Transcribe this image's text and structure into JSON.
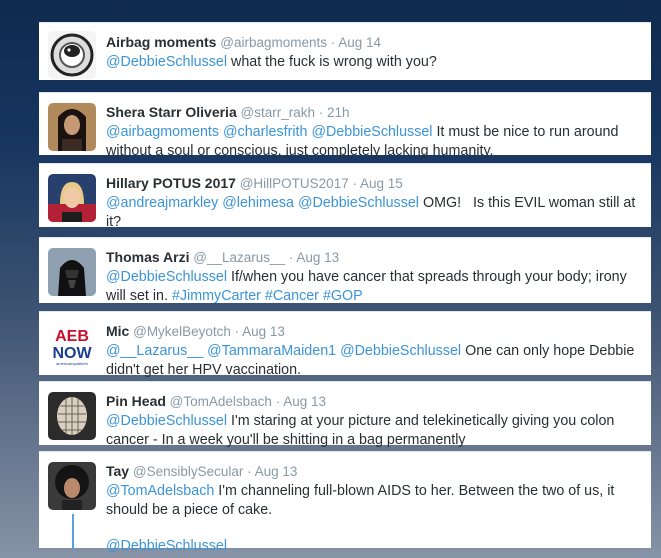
{
  "tweets": [
    {
      "name": "Airbag moments",
      "handle": "@airbagmoments",
      "sep": "·",
      "time": "Aug 14",
      "parts": [
        {
          "t": "@DebbieSchlussel",
          "k": "m"
        },
        {
          "t": " what the fuck is wrong with you?",
          "k": "p"
        }
      ],
      "avatar": "hamster-on-wheel-avatar"
    },
    {
      "name": "Shera Starr Oliveria",
      "handle": "@starr_rakh",
      "sep": "·",
      "time": "21h",
      "parts": [
        {
          "t": "@airbagmoments",
          "k": "m"
        },
        {
          "t": " ",
          "k": "p"
        },
        {
          "t": "@charlesfrith",
          "k": "m"
        },
        {
          "t": " ",
          "k": "p"
        },
        {
          "t": "@DebbieSchlussel",
          "k": "m"
        },
        {
          "t": " It must be nice to run around without a soul or conscious, just completely lacking humanity.",
          "k": "p"
        }
      ],
      "avatar": "woman-dark-hair-avatar"
    },
    {
      "name": "Hillary POTUS 2017",
      "handle": "@HillPOTUS2017",
      "sep": "·",
      "time": "Aug 15",
      "parts": [
        {
          "t": "@andreajmarkley",
          "k": "m"
        },
        {
          "t": " ",
          "k": "p"
        },
        {
          "t": "@lehimesa",
          "k": "m"
        },
        {
          "t": " ",
          "k": "p"
        },
        {
          "t": "@DebbieSchlussel",
          "k": "m"
        },
        {
          "t": " OMG!   Is this EVIL woman still at it?",
          "k": "p"
        }
      ],
      "avatar": "hillary-portrait-avatar"
    },
    {
      "name": "Thomas Arzi",
      "handle": "@__Lazarus__",
      "sep": "·",
      "time": "Aug 13",
      "parts": [
        {
          "t": "@DebbieSchlussel",
          "k": "m"
        },
        {
          "t": " If/when you have cancer that spreads through your body; irony will set in. ",
          "k": "p"
        },
        {
          "t": "#JimmyCarter",
          "k": "m"
        },
        {
          "t": " ",
          "k": "p"
        },
        {
          "t": "#Cancer",
          "k": "m"
        },
        {
          "t": " ",
          "k": "p"
        },
        {
          "t": "#GOP",
          "k": "m"
        }
      ],
      "avatar": "vader-avatar"
    },
    {
      "name": "Mic",
      "handle": "@MykelBeyotch",
      "sep": "·",
      "time": "Aug 13",
      "parts": [
        {
          "t": "@__Lazarus__",
          "k": "m"
        },
        {
          "t": " ",
          "k": "p"
        },
        {
          "t": "@TammaraMaiden1",
          "k": "m"
        },
        {
          "t": " ",
          "k": "p"
        },
        {
          "t": "@DebbieSchlussel",
          "k": "m"
        },
        {
          "t": " One can only hope Debbie didn't get her HPV vaccination.",
          "k": "p"
        }
      ],
      "avatar": "aeb-now-logo-avatar",
      "logo_top": "AEB",
      "logo_bottom": "NOW",
      "logo_small": "americaequalbirth"
    },
    {
      "name": "Pin Head",
      "handle": "@TomAdelsbach",
      "sep": "·",
      "time": "Aug 13",
      "parts": [
        {
          "t": "@DebbieSchlussel",
          "k": "m"
        },
        {
          "t": " I'm staring at your picture and telekinetically giving you colon cancer - In a week you'll be shitting in a bag permanently",
          "k": "p"
        }
      ],
      "avatar": "pinhead-avatar"
    },
    {
      "name": "Tay",
      "handle": "@SensiblySecular",
      "sep": "·",
      "time": "Aug 13",
      "parts": [
        {
          "t": "@TomAdelsbach",
          "k": "m"
        },
        {
          "t": " I'm channeling full-blown AIDS to her. Between the two of us, it should be a piece of cake.",
          "k": "p"
        }
      ],
      "extra": "@DebbieSchlussel",
      "avatar": "woman-curly-hair-avatar"
    }
  ],
  "colors": {
    "mention": "#3b94d9",
    "name": "#292f33",
    "meta": "#8899a6"
  }
}
